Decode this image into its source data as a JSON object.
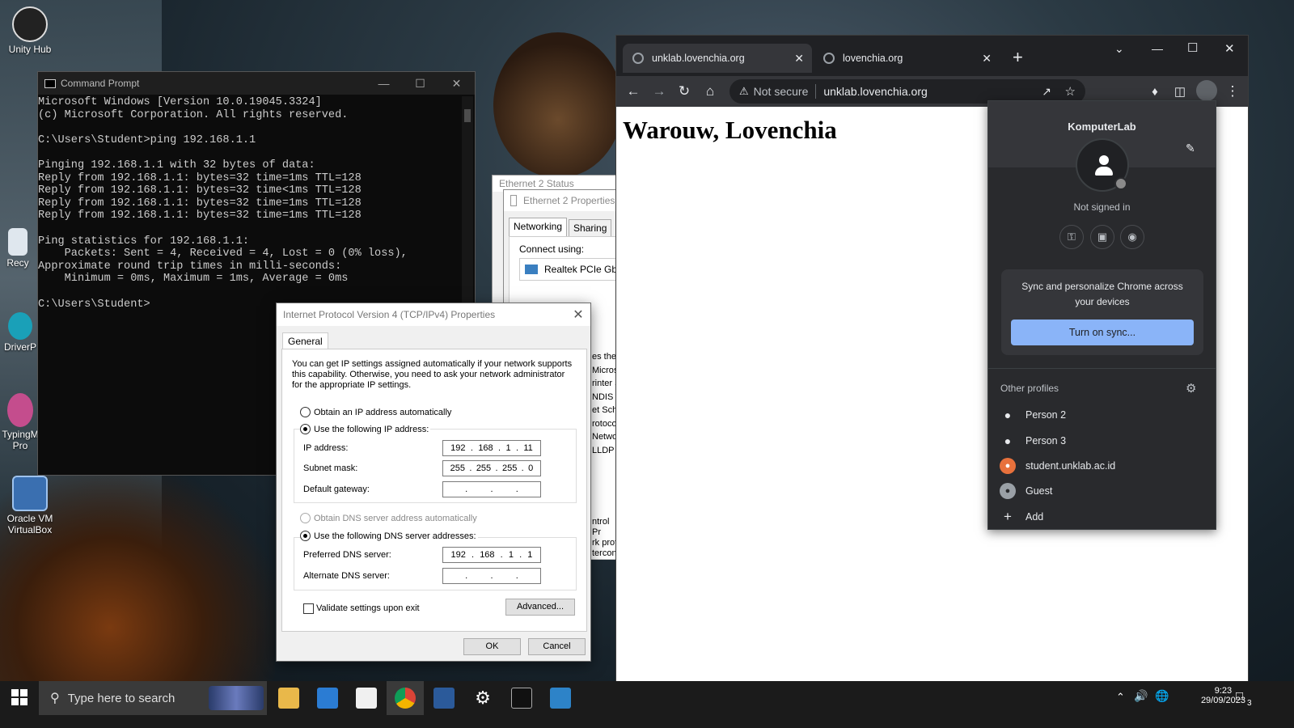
{
  "desktop": {
    "icons": [
      {
        "label": "Unity Hub"
      },
      {
        "label": "Recy"
      },
      {
        "label": "DriverP"
      },
      {
        "label": "TypingM Pro"
      },
      {
        "label": "Oracle VM VirtualBox"
      }
    ]
  },
  "cmd": {
    "title": "Command Prompt",
    "lines": "Microsoft Windows [Version 10.0.19045.3324]\n(c) Microsoft Corporation. All rights reserved.\n\nC:\\Users\\Student>ping 192.168.1.1\n\nPinging 192.168.1.1 with 32 bytes of data:\nReply from 192.168.1.1: bytes=32 time=1ms TTL=128\nReply from 192.168.1.1: bytes=32 time<1ms TTL=128\nReply from 192.168.1.1: bytes=32 time=1ms TTL=128\nReply from 192.168.1.1: bytes=32 time=1ms TTL=128\n\nPing statistics for 192.168.1.1:\n    Packets: Sent = 4, Received = 4, Lost = 0 (0% loss),\nApproximate round trip times in milli-seconds:\n    Minimum = 0ms, Maximum = 1ms, Average = 0ms\n\nC:\\Users\\Student>"
  },
  "eth_status": {
    "title": "Ethernet 2 Status"
  },
  "eth_props": {
    "title": "Ethernet 2 Properties",
    "tabs": [
      "Networking",
      "Sharing"
    ],
    "connect_using": "Connect using:",
    "adapter": "Realtek PCIe GbE",
    "list": [
      "es the",
      "Microso",
      "rinter S",
      "NDIS",
      "et Sch",
      "rotocol",
      "Netwo",
      "LLDP I",
      "",
      "",
      "",
      "ntrol Pr",
      "rk prot",
      "tercon"
    ]
  },
  "ipv4": {
    "title": "Internet Protocol Version 4 (TCP/IPv4) Properties",
    "tab": "General",
    "desc": "You can get IP settings assigned automatically if your network supports this capability. Otherwise, you need to ask your network administrator for the appropriate IP settings.",
    "obtain_ip": "Obtain an IP address automatically",
    "use_ip": "Use the following IP address:",
    "ip_label": "IP address:",
    "ip": [
      "192",
      "168",
      "1",
      "11"
    ],
    "mask_label": "Subnet mask:",
    "mask": [
      "255",
      "255",
      "255",
      "0"
    ],
    "gw_label": "Default gateway:",
    "obtain_dns": "Obtain DNS server address automatically",
    "use_dns": "Use the following DNS server addresses:",
    "pref_label": "Preferred DNS server:",
    "pref": [
      "192",
      "168",
      "1",
      "1"
    ],
    "alt_label": "Alternate DNS server:",
    "validate": "Validate settings upon exit",
    "advanced": "Advanced...",
    "ok": "OK",
    "cancel": "Cancel"
  },
  "chrome": {
    "tabs": [
      {
        "title": "unklab.lovenchia.org"
      },
      {
        "title": "lovenchia.org"
      }
    ],
    "not_secure": "Not secure",
    "url": "unklab.lovenchia.org",
    "heading": "Warouw, Lovenchia",
    "profile": {
      "name": "KomputerLab",
      "status": "Not signed in",
      "sync_text": "Sync and personalize Chrome across your devices",
      "sync_button": "Turn on sync...",
      "other_profiles": "Other profiles",
      "items": [
        "Person 2",
        "Person 3",
        "student.unklab.ac.id",
        "Guest",
        "Add"
      ]
    }
  },
  "taskbar": {
    "search_placeholder": "Type here to search",
    "time": "9:23",
    "date": "29/09/2023",
    "notif_count": "3"
  }
}
